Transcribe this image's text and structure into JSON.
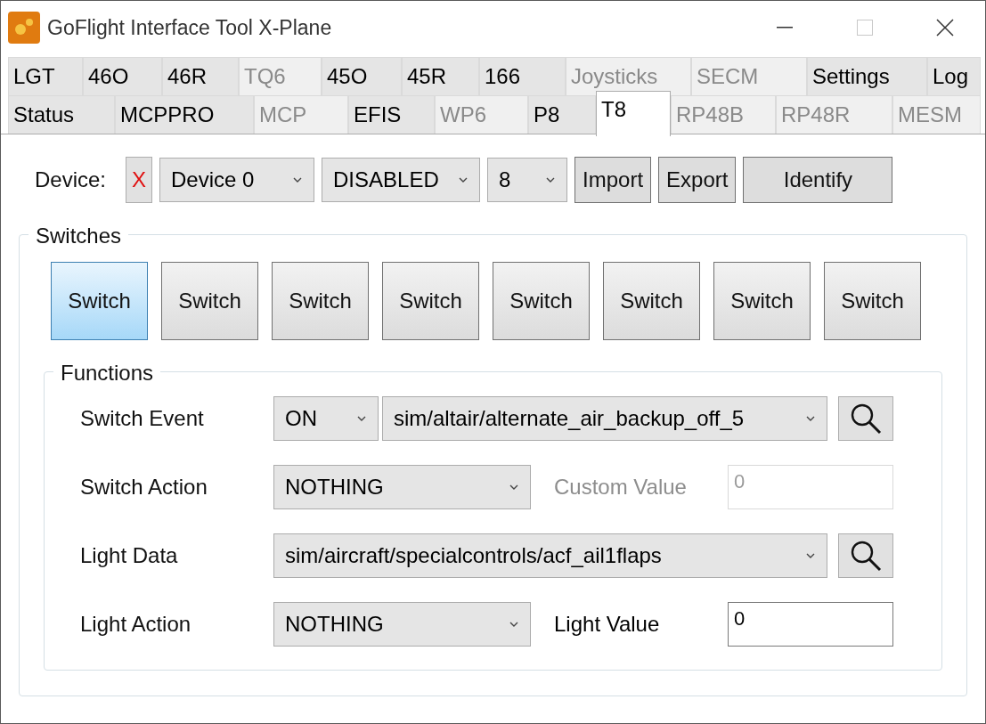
{
  "window": {
    "title": "GoFlight Interface Tool X-Plane"
  },
  "tab_rows": [
    [
      {
        "label": "LGT",
        "selected": false,
        "disabled": false
      },
      {
        "label": "46O",
        "selected": false,
        "disabled": false
      },
      {
        "label": "46R",
        "selected": false,
        "disabled": false
      },
      {
        "label": "TQ6",
        "selected": false,
        "disabled": true
      },
      {
        "label": "45O",
        "selected": false,
        "disabled": false
      },
      {
        "label": "45R",
        "selected": false,
        "disabled": false
      },
      {
        "label": "166",
        "selected": false,
        "disabled": false
      },
      {
        "label": "Joysticks",
        "selected": false,
        "disabled": true
      },
      {
        "label": "SECM",
        "selected": false,
        "disabled": true
      },
      {
        "label": "Settings",
        "selected": false,
        "disabled": false
      },
      {
        "label": "Log",
        "selected": false,
        "disabled": false
      }
    ],
    [
      {
        "label": "Status",
        "selected": false,
        "disabled": false
      },
      {
        "label": "MCPPRO",
        "selected": false,
        "disabled": false
      },
      {
        "label": "MCP",
        "selected": false,
        "disabled": true
      },
      {
        "label": "EFIS",
        "selected": false,
        "disabled": false
      },
      {
        "label": "WP6",
        "selected": false,
        "disabled": true
      },
      {
        "label": "P8",
        "selected": false,
        "disabled": false
      },
      {
        "label": "T8",
        "selected": true,
        "disabled": false
      },
      {
        "label": "RP48B",
        "selected": false,
        "disabled": true
      },
      {
        "label": "RP48R",
        "selected": false,
        "disabled": true
      },
      {
        "label": "MESM",
        "selected": false,
        "disabled": true
      }
    ]
  ],
  "device": {
    "label": "Device:",
    "status": "X",
    "dropdowns": [
      "Device 0",
      "DISABLED",
      "8"
    ],
    "buttons": [
      "Import",
      "Export",
      "Identify"
    ]
  },
  "switches": {
    "title": "Switches",
    "items": [
      {
        "label": "Switch",
        "selected": true
      },
      {
        "label": "Switch",
        "selected": false
      },
      {
        "label": "Switch",
        "selected": false
      },
      {
        "label": "Switch",
        "selected": false
      },
      {
        "label": "Switch",
        "selected": false
      },
      {
        "label": "Switch",
        "selected": false
      },
      {
        "label": "Switch",
        "selected": false
      },
      {
        "label": "Switch",
        "selected": false
      }
    ]
  },
  "functions": {
    "title": "Functions",
    "rows": [
      {
        "kind": "select-search",
        "label": "Switch Event",
        "dropdowns": [
          "ON",
          "sim/altair/alternate_air_backup_off_5"
        ]
      },
      {
        "kind": "select-value",
        "label": "Switch Action",
        "dropdown": "NOTHING",
        "value_label": "Custom Value",
        "value": "0",
        "disabled": true
      },
      {
        "kind": "select-search",
        "label": "Light Data",
        "dropdowns": [
          "sim/aircraft/specialcontrols/acf_ail1flaps"
        ]
      },
      {
        "kind": "select-value",
        "label": "Light Action",
        "dropdown": "NOTHING",
        "value_label": "Light Value",
        "value": "0",
        "disabled": false
      }
    ]
  }
}
